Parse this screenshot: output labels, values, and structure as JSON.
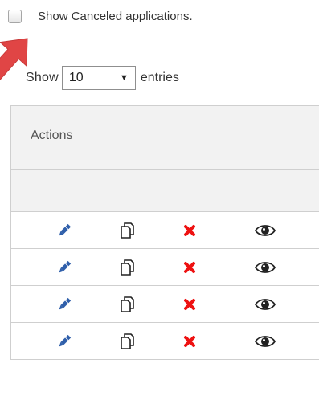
{
  "filter": {
    "checkbox_label": "Show Canceled applications.",
    "checked": false
  },
  "length_menu": {
    "show_label": "Show",
    "selected": "10",
    "entries_label": "entries"
  },
  "table": {
    "columns": [
      "Actions"
    ],
    "rows": [
      {
        "actions": [
          "edit-icon",
          "copy-icon",
          "delete-icon",
          "view-icon"
        ]
      },
      {
        "actions": [
          "edit-icon",
          "copy-icon",
          "delete-icon",
          "view-icon"
        ]
      },
      {
        "actions": [
          "edit-icon",
          "copy-icon",
          "delete-icon",
          "view-icon"
        ]
      },
      {
        "actions": [
          "edit-icon",
          "copy-icon",
          "delete-icon",
          "view-icon"
        ]
      }
    ]
  },
  "colors": {
    "edit": "#2f5faa",
    "delete": "#ee1111",
    "annotation_arrow": "#e04545"
  }
}
